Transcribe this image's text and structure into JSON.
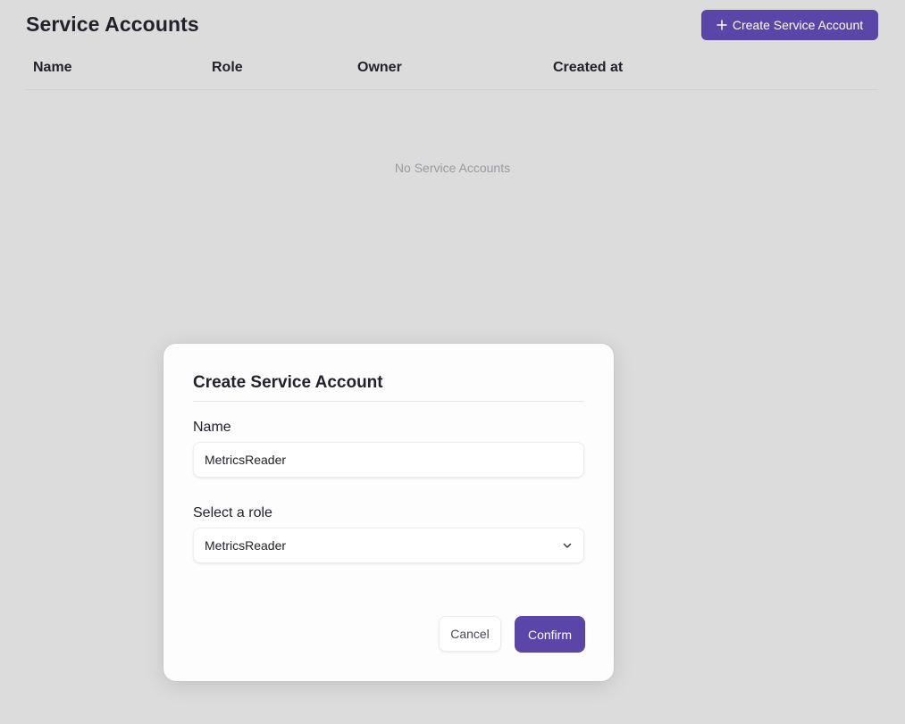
{
  "page": {
    "title": "Service Accounts",
    "create_button_label": "Create Service Account",
    "create_button_icon": "plus-icon"
  },
  "table": {
    "columns": [
      "Name",
      "Role",
      "Owner",
      "Created at"
    ],
    "rows": [],
    "empty_text": "No Service Accounts"
  },
  "modal": {
    "title": "Create Service Account",
    "name_label": "Name",
    "name_value": "MetricsReader",
    "role_label": "Select a role",
    "role_value": "MetricsReader",
    "role_dropdown_icon": "chevron-down-icon",
    "cancel_label": "Cancel",
    "confirm_label": "Confirm"
  },
  "colors": {
    "accent": "#5a45a8",
    "backdrop": "#dcdcdc",
    "modal_bg": "#fdfdfd"
  }
}
